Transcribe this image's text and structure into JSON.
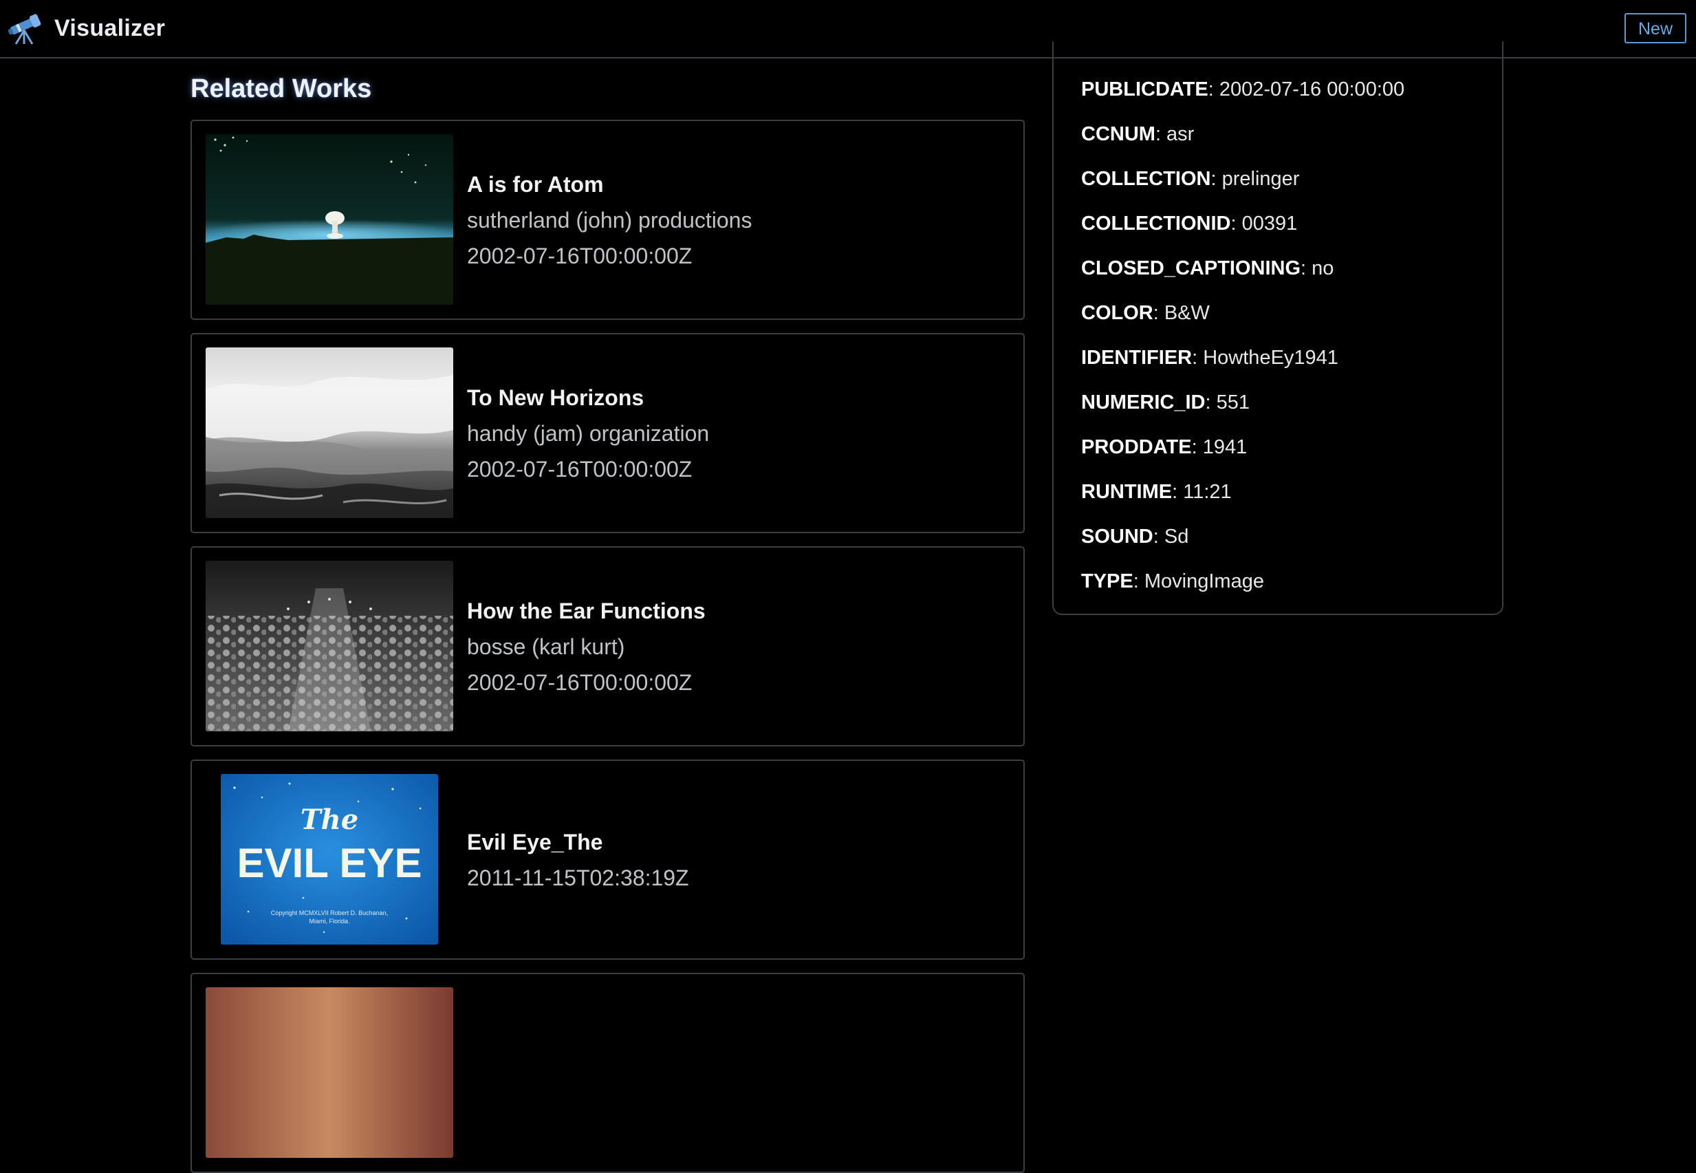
{
  "app": {
    "title": "Visualizer",
    "logo_icon": "telescope-icon",
    "new_button_label": "New"
  },
  "related": {
    "heading": "Related Works",
    "items": [
      {
        "title": "A is for Atom",
        "line1": "sutherland (john) productions",
        "line2": "2002-07-16T00:00:00Z",
        "thumb": "atom-explosion-thumbnail"
      },
      {
        "title": "To New Horizons",
        "line1": "handy (jam) organization",
        "line2": "2002-07-16T00:00:00Z",
        "thumb": "ocean-waves-thumbnail"
      },
      {
        "title": "How the Ear Functions",
        "line1": "bosse (karl kurt)",
        "line2": "2002-07-16T00:00:00Z",
        "thumb": "audience-crowd-thumbnail"
      },
      {
        "title": "Evil Eye_The",
        "line1": "2011-11-15T02:38:19Z",
        "thumb": "evil-eye-title-card-thumbnail",
        "thumb_title_small": "The",
        "thumb_title_big": "EVIL EYE",
        "thumb_copyright_1": "Copyright MCMXLVII Robert D. Buchanan,",
        "thumb_copyright_2": "Miami, Florida."
      }
    ]
  },
  "properties": [
    {
      "key": "PUBLICDATE",
      "value": ": 2002-07-16 00:00:00"
    },
    {
      "key": "CCNUM",
      "value": ": asr"
    },
    {
      "key": "COLLECTION",
      "value": ": prelinger"
    },
    {
      "key": "COLLECTIONID",
      "value": ": 00391"
    },
    {
      "key": "CLOSED_CAPTIONING",
      "value": ": no"
    },
    {
      "key": "COLOR",
      "value": ": B&W"
    },
    {
      "key": "IDENTIFIER",
      "value": ": HowtheEy1941"
    },
    {
      "key": "NUMERIC_ID",
      "value": ": 551"
    },
    {
      "key": "PRODDATE",
      "value": ": 1941"
    },
    {
      "key": "RUNTIME",
      "value": ": 11:21"
    },
    {
      "key": "SOUND",
      "value": ": Sd"
    },
    {
      "key": "TYPE",
      "value": ": MovingImage"
    }
  ],
  "colors": {
    "accent": "#5b9ad6",
    "border": "#3b3e43",
    "background": "#000000"
  }
}
